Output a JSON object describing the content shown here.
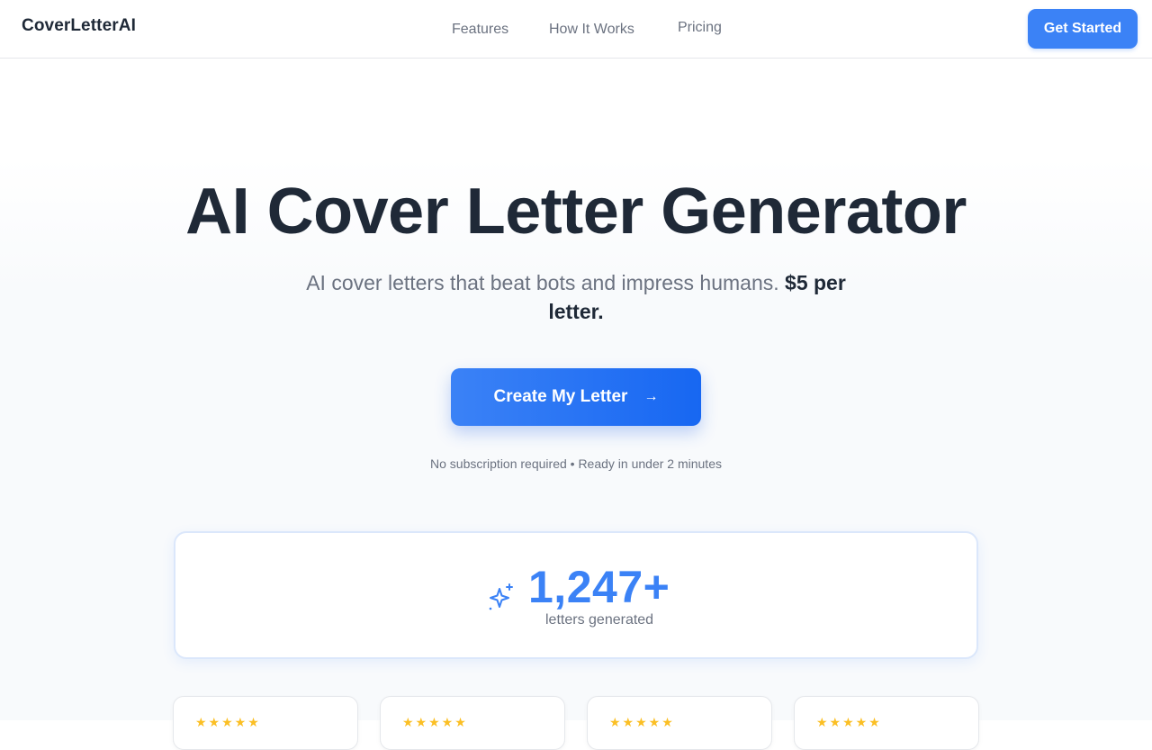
{
  "nav": {
    "brand": "CoverLetterAI",
    "links": [
      "Features",
      "How It Works",
      "Pricing"
    ],
    "cta_label": "Get Started"
  },
  "hero": {
    "title": "AI Cover Letter Generator",
    "subtitle_text": "AI cover letters that beat bots and impress humans.",
    "subtitle_price": "$5 per letter.",
    "cta_label": "Create My Letter",
    "cta_icon": "arrow-right-icon",
    "fine_print": "No subscription required • Ready in under 2 minutes"
  },
  "stats": {
    "icon": "sparkle-icon",
    "count": "1,247+",
    "label": "letters generated"
  },
  "testimonials": {
    "rating_stars": 5,
    "visible_count": 4
  },
  "colors": {
    "accent": "#3b82f6",
    "text_dark": "#1f2937",
    "text_muted": "#6b7280",
    "star": "#fbbf24"
  }
}
